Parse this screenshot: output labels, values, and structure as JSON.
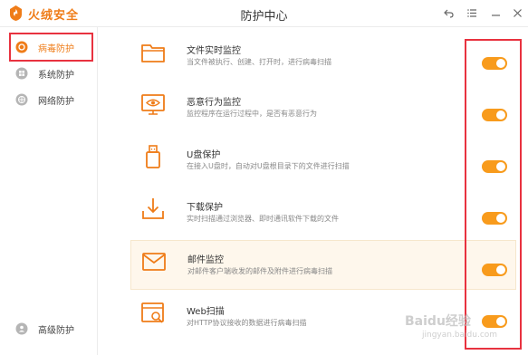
{
  "app": {
    "name": "火绒安全",
    "window_title": "防护中心",
    "accent_color": "#ef7c18",
    "toggle_color": "#f89b1c"
  },
  "window_controls": {
    "back_icon": "back-arrow-icon",
    "menu_icon": "menu-icon",
    "minimize_icon": "minimize-icon",
    "close_icon": "close-icon"
  },
  "sidebar": {
    "items": [
      {
        "label": "病毒防护",
        "icon": "virus-shield-icon",
        "active": true
      },
      {
        "label": "系统防护",
        "icon": "windows-icon",
        "active": false
      },
      {
        "label": "网络防护",
        "icon": "globe-icon",
        "active": false
      }
    ],
    "bottom_item": {
      "label": "高级防护",
      "icon": "advanced-icon"
    }
  },
  "protections": [
    {
      "title": "文件实时监控",
      "desc": "当文件被执行、创建、打开时，进行病毒扫描",
      "icon": "folder-icon",
      "enabled": true
    },
    {
      "title": "恶意行为监控",
      "desc": "监控程序在运行过程中，是否有恶意行为",
      "icon": "monitor-eye-icon",
      "enabled": true
    },
    {
      "title": "U盘保护",
      "desc": "在接入U盘时，自动对U盘根目录下的文件进行扫描",
      "icon": "usb-drive-icon",
      "enabled": true
    },
    {
      "title": "下载保护",
      "desc": "实时扫描通过浏览器、即时通讯软件下载的文件",
      "icon": "download-icon",
      "enabled": true
    },
    {
      "title": "邮件监控",
      "desc": "对邮件客户端收发的邮件及附件进行病毒扫描",
      "icon": "mail-icon",
      "enabled": true
    },
    {
      "title": "Web扫描",
      "desc": "对HTTP协议接收的数据进行病毒扫描",
      "icon": "web-scan-icon",
      "enabled": true
    }
  ],
  "watermark": {
    "text": "Baidu经验",
    "sub": "jingyan.baidu.com"
  }
}
